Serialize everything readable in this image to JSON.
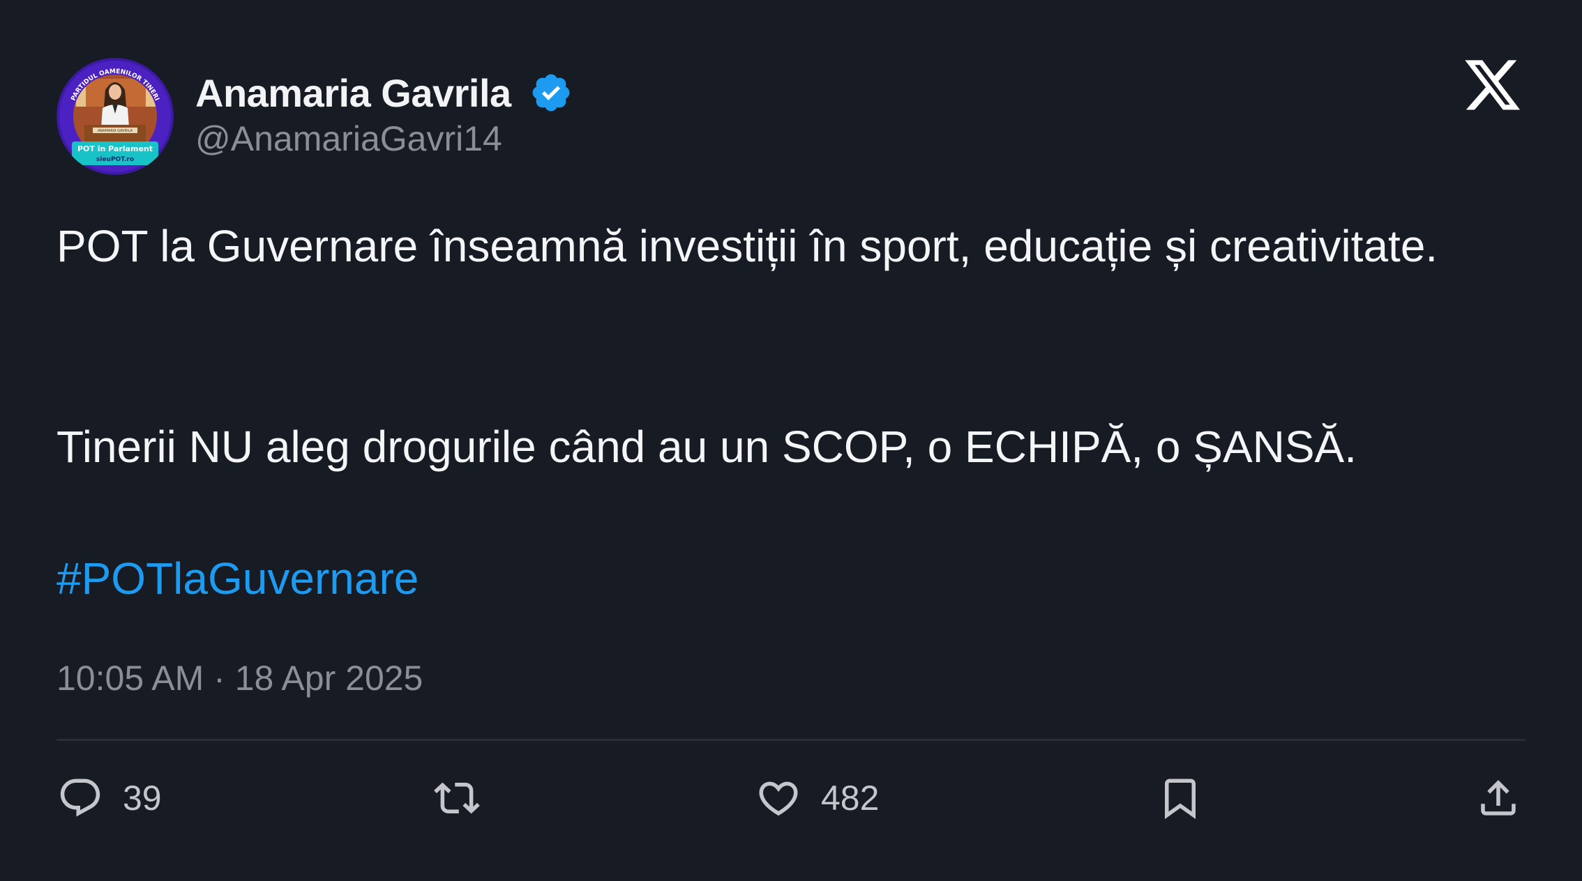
{
  "author": {
    "display_name": "Anamaria Gavrila",
    "handle": "@AnamariaGavri14",
    "verified": true,
    "avatar": {
      "ring_text": "PARTIDUL OAMENILOR TINERI",
      "podium_text": "ANAMARIA GAVRILA",
      "banner_line_1": "POT în Parlament",
      "banner_line_2": "sieuPOT.ro"
    }
  },
  "platform": {
    "logo": "x-logo-icon"
  },
  "tweet": {
    "line_1": "POT la Guvernare înseamnă investiții în sport, educație și creativitate.",
    "line_2": "Tinerii NU aleg drogurile când au un SCOP, o ECHIPĂ, o ȘANSĂ.",
    "hashtag": "#POTlaGuvernare",
    "timestamp": "10:05 AM · 18 Apr 2025"
  },
  "actions": {
    "reply": {
      "icon": "reply-icon",
      "count": "39"
    },
    "retweet": {
      "icon": "retweet-icon",
      "count": ""
    },
    "like": {
      "icon": "heart-icon",
      "count": "482"
    },
    "bookmark": {
      "icon": "bookmark-icon"
    },
    "share": {
      "icon": "share-icon"
    }
  },
  "colors": {
    "background": "#171b24",
    "text": "#f4f5f7",
    "muted": "#8b8e95",
    "link": "#1d9bf0",
    "verified": "#1d9bf0",
    "avatar_ring": "#4a1fb8",
    "banner": "#18c3c8"
  }
}
